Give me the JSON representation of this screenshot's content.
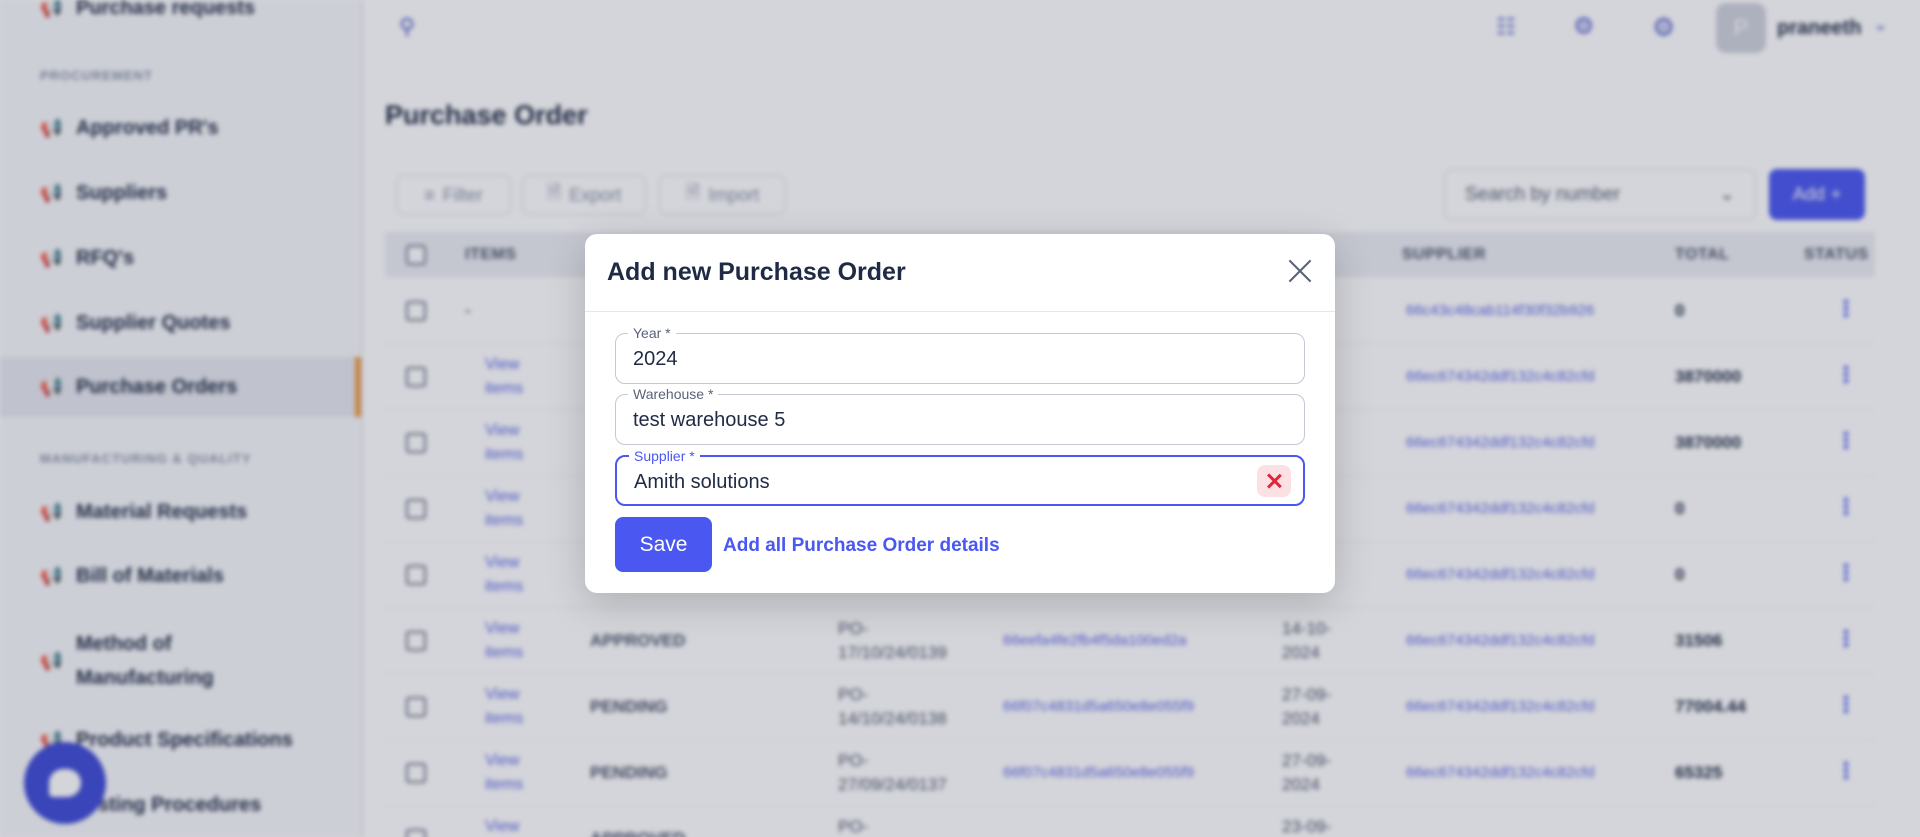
{
  "sidebar": {
    "partial_top_item": "Purchase requests",
    "sections": [
      {
        "label": "PROCUREMENT"
      },
      {
        "label": "MANUFACTURING & QUALITY"
      }
    ],
    "items": [
      {
        "label": "Approved PR's"
      },
      {
        "label": "Suppliers"
      },
      {
        "label": "RFQ's"
      },
      {
        "label": "Supplier Quotes"
      },
      {
        "label": "Purchase Orders",
        "active": true
      },
      {
        "label": "Material Requests"
      },
      {
        "label": "Bill of Materials"
      },
      {
        "label": "Method of Manufacturing"
      },
      {
        "label": "Product Specifications"
      },
      {
        "label": "Testing Procedures"
      }
    ]
  },
  "header": {
    "username": "praneeth",
    "avatar_initial": "P"
  },
  "page": {
    "title": "Purchase Order",
    "toolbar": {
      "filter_label": "Filter",
      "export_label": "Export",
      "import_label": "Import",
      "search_placeholder": "Search by number",
      "add_label": "Add"
    }
  },
  "table": {
    "columns": {
      "items": "ITEMS",
      "supplier": "SUPPLIER",
      "total": "TOTAL",
      "status": "STATUS"
    },
    "rows": [
      {
        "items": "-",
        "state": "",
        "po": "",
        "id": "",
        "date": "",
        "supplier": "66c43c48cab114f30f32b926",
        "total": "0"
      },
      {
        "items": "View items",
        "state": "",
        "po": "",
        "id": "",
        "date": "",
        "supplier": "66ec674342ddf132c4c82cfd",
        "total": "3870000"
      },
      {
        "items": "View items",
        "state": "",
        "po": "",
        "id": "",
        "date": "",
        "supplier": "66ec674342ddf132c4c82cfd",
        "total": "3870000"
      },
      {
        "items": "View items",
        "state": "",
        "po": "",
        "id": "",
        "date": "",
        "supplier": "66ec674342ddf132c4c82cfd",
        "total": "0"
      },
      {
        "items": "View items",
        "state": "",
        "po": "",
        "id": "",
        "date": "",
        "supplier": "66ec674342ddf132c4c82cfd",
        "total": "0"
      },
      {
        "items": "View items",
        "state": "APPROVED",
        "po": "PO-17/10/24/0139",
        "id": "66eefa4fe2fb4f5da100ed2a",
        "date": "14-10-2024",
        "supplier": "66ec674342ddf132c4c82cfd",
        "total": "31506"
      },
      {
        "items": "View items",
        "state": "PENDING",
        "po": "PO-14/10/24/0138",
        "id": "66f07c4831d5a650e8e055f9",
        "date": "27-09-2024",
        "supplier": "66ec674342ddf132c4c82cfd",
        "total": "77004.44"
      },
      {
        "items": "View items",
        "state": "PENDING",
        "po": "PO-27/09/24/0137",
        "id": "66f07c4831d5a650e8e055f9",
        "date": "27-09-2024",
        "supplier": "66ec674342ddf132c4c82cfd",
        "total": "65325"
      },
      {
        "items": "View",
        "state": "APPROVED",
        "po": "PO-",
        "id": "",
        "date": "23-09-",
        "supplier": "",
        "total": ""
      }
    ]
  },
  "modal": {
    "title": "Add new Purchase Order",
    "fields": {
      "year": {
        "label": "Year *",
        "value": "2024"
      },
      "warehouse": {
        "label": "Warehouse *",
        "value": "test warehouse 5"
      },
      "supplier": {
        "label": "Supplier *",
        "value": "Amith solutions"
      }
    },
    "save_label": "Save",
    "details_link": "Add all Purchase Order details"
  },
  "colors": {
    "accent": "#4a57f0",
    "active_indicator": "#f09a43",
    "danger": "#e0263c"
  }
}
